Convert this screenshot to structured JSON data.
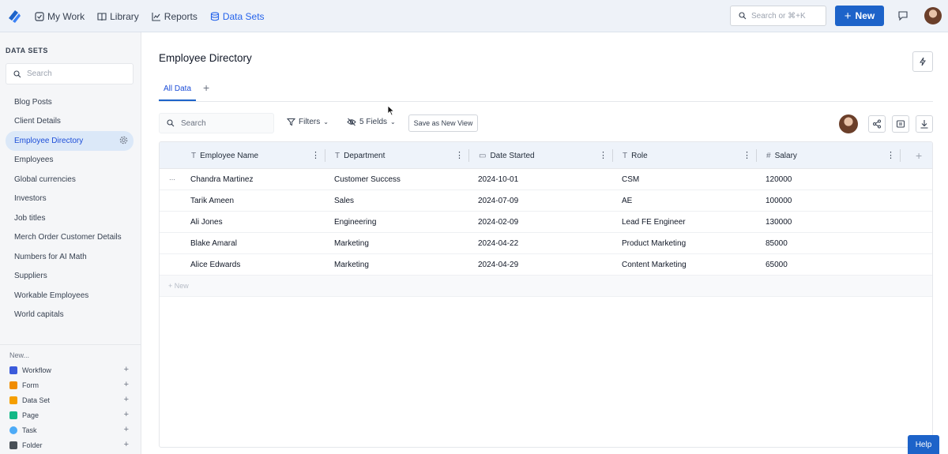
{
  "nav": {
    "items": [
      {
        "label": "My Work",
        "icon": "check-square-icon"
      },
      {
        "label": "Library",
        "icon": "book-icon"
      },
      {
        "label": "Reports",
        "icon": "chart-line-icon"
      },
      {
        "label": "Data Sets",
        "icon": "database-icon"
      }
    ],
    "search_placeholder": "Search or ⌘+K",
    "new_label": "New"
  },
  "sidebar": {
    "title": "DATA SETS",
    "search_placeholder": "Search",
    "items": [
      "Blog Posts",
      "Client Details",
      "Employee Directory",
      "Employees",
      "Global currencies",
      "Investors",
      "Job titles",
      "Merch Order Customer Details",
      "Numbers for AI Math",
      "Suppliers",
      "Workable Employees",
      "World capitals"
    ],
    "active_item": "Employee Directory",
    "new_label": "New...",
    "new_items": [
      {
        "label": "Workflow",
        "color": "#3b5bdb"
      },
      {
        "label": "Form",
        "color": "#f08c00"
      },
      {
        "label": "Data Set",
        "color": "#f59f00"
      },
      {
        "label": "Page",
        "color": "#12b886"
      },
      {
        "label": "Task",
        "color": "#4dabf7"
      },
      {
        "label": "Folder",
        "color": "#495057"
      }
    ]
  },
  "main": {
    "title": "Employee Directory",
    "tab_label": "All Data",
    "toolbar": {
      "search_placeholder": "Search",
      "filters_label": "Filters",
      "fields_label": "5 Fields",
      "save_view_label": "Save as New View"
    },
    "table": {
      "columns": [
        {
          "label": "Employee Name",
          "type_icon": "T"
        },
        {
          "label": "Department",
          "type_icon": "T"
        },
        {
          "label": "Date Started",
          "type_icon": "▭"
        },
        {
          "label": "Role",
          "type_icon": "T"
        },
        {
          "label": "Salary",
          "type_icon": "#"
        }
      ],
      "rows": [
        [
          "Chandra Martinez",
          "Customer Success",
          "2024-10-01",
          "CSM",
          "120000"
        ],
        [
          "Tarik Ameen",
          "Sales",
          "2024-07-09",
          "AE",
          "100000"
        ],
        [
          "Ali Jones",
          "Engineering",
          "2024-02-09",
          "Lead FE Engineer",
          "130000"
        ],
        [
          "Blake Amaral",
          "Marketing",
          "2024-04-22",
          "Product Marketing",
          "85000"
        ],
        [
          "Alice Edwards",
          "Marketing",
          "2024-04-29",
          "Content Marketing",
          "65000"
        ]
      ],
      "new_row_label": "+ New"
    },
    "help_label": "Help"
  },
  "colors": {
    "accent": "#1d63c9",
    "topbar_bg": "#eef2f8",
    "sidebar_bg": "#f5f6f8",
    "active_item_bg": "#dbe8f8"
  }
}
